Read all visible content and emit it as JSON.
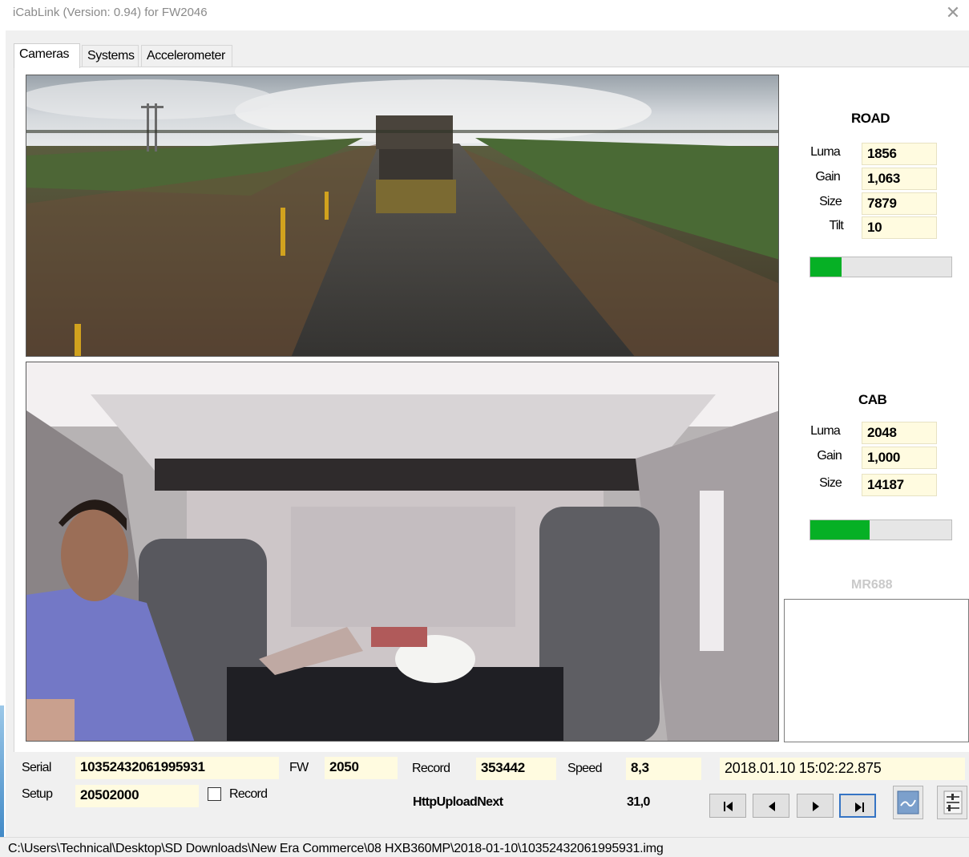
{
  "window": {
    "title": "iCabLink (Version: 0.94) for FW2046",
    "close_glyph": "✕"
  },
  "tabs": [
    {
      "label": "Cameras",
      "active": true
    },
    {
      "label": "Systems",
      "active": false
    },
    {
      "label": "Accelerometer",
      "active": false
    }
  ],
  "road": {
    "title": "ROAD",
    "luma_label": "Luma",
    "luma": "1856",
    "gain_label": "Gain",
    "gain": "1,063",
    "size_label": "Size",
    "size": "7879",
    "tilt_label": "Tilt",
    "tilt": "10",
    "level": 0.22
  },
  "cab": {
    "title": "CAB",
    "luma_label": "Luma",
    "luma": "2048",
    "gain_label": "Gain",
    "gain": "1,000",
    "size_label": "Size",
    "size": "14187",
    "level": 0.42
  },
  "mr": {
    "label": "MR688"
  },
  "bottom": {
    "serial_label": "Serial",
    "serial": "10352432061995931",
    "fw_label": "FW",
    "fw": "2050",
    "record_label": "Record",
    "record": "353442",
    "speed_label": "Speed",
    "speed": "8,3",
    "datetime": "2018.01.10 15:02:22.875",
    "setup_label": "Setup",
    "setup": "20502000",
    "record_checkbox_label": "Record",
    "upload_label": "HttpUploadNext",
    "upload_value": "31,0"
  },
  "icons": {
    "first": "skip-to-start-icon",
    "prev": "step-back-icon",
    "next": "step-forward-icon",
    "last": "skip-to-end-icon",
    "image": "image-export-icon",
    "settings": "settings-sliders-icon"
  },
  "colors": {
    "bar_fill": "#06b025",
    "value_bg": "#fffbe0",
    "highlight_border": "#3574c4"
  },
  "status": {
    "path": "C:\\Users\\Technical\\Desktop\\SD Downloads\\New Era Commerce\\08 HXB360MP\\2018-01-10\\10352432061995931.img"
  }
}
